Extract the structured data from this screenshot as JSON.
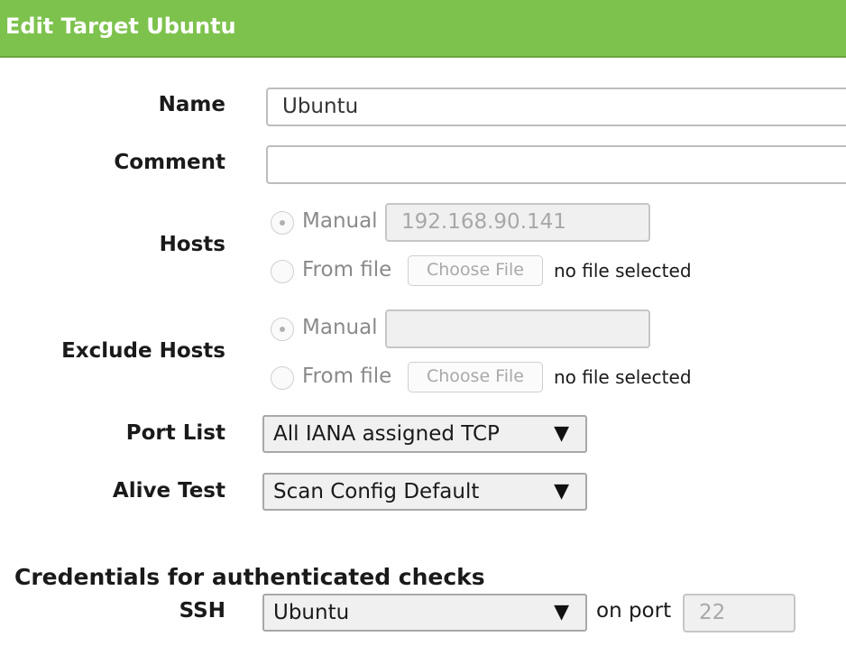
{
  "dialog": {
    "title": "Edit Target Ubuntu"
  },
  "form": {
    "name": {
      "label": "Name",
      "value": "Ubuntu"
    },
    "comment": {
      "label": "Comment",
      "value": ""
    },
    "hosts": {
      "label": "Hosts",
      "manual_label": "Manual",
      "manual_value": "192.168.90.141",
      "fromfile_label": "From file",
      "choose_file_label": "Choose File",
      "file_status": "no file selected",
      "selected": "manual"
    },
    "exclude_hosts": {
      "label": "Exclude Hosts",
      "manual_label": "Manual",
      "manual_value": "",
      "fromfile_label": "From file",
      "choose_file_label": "Choose File",
      "file_status": "no file selected",
      "selected": "manual"
    },
    "port_list": {
      "label": "Port List",
      "value": "All IANA assigned TCP"
    },
    "alive_test": {
      "label": "Alive Test",
      "value": "Scan Config Default"
    }
  },
  "credentials": {
    "heading": "Credentials for authenticated checks",
    "ssh": {
      "label": "SSH",
      "value": "Ubuntu",
      "on_port_label": "on port",
      "port": "22"
    }
  },
  "icons": {
    "dropdown": "▼"
  },
  "colors": {
    "header_green": "#7dc24d",
    "header_text": "#ffffff"
  }
}
